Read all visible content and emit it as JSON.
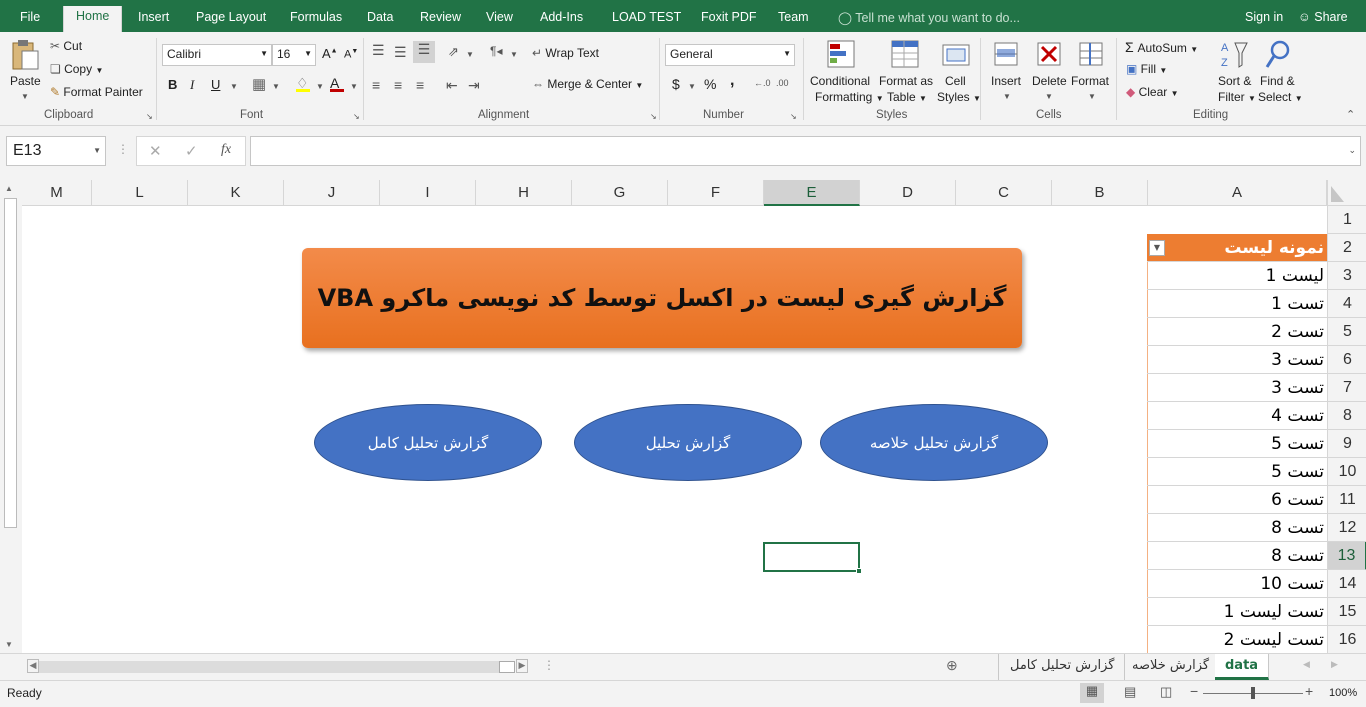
{
  "menu": {
    "tabs": [
      "File",
      "Home",
      "Insert",
      "Page Layout",
      "Formulas",
      "Data",
      "Review",
      "View",
      "Add-Ins",
      "LOAD TEST",
      "Foxit PDF",
      "Team"
    ],
    "active": "Home",
    "tell_me": "Tell me what you want to do...",
    "sign_in": "Sign in",
    "share": "Share"
  },
  "ribbon": {
    "clipboard": {
      "paste": "Paste",
      "cut": "Cut",
      "copy": "Copy",
      "format_painter": "Format Painter",
      "label": "Clipboard"
    },
    "font": {
      "name": "Calibri",
      "size": "16",
      "bold": "B",
      "italic": "I",
      "underline": "U",
      "label": "Font"
    },
    "alignment": {
      "wrap_text": "Wrap Text",
      "merge_center": "Merge & Center",
      "label": "Alignment"
    },
    "number": {
      "format": "General",
      "currency": "$",
      "percent": "%",
      "comma": ",",
      "label": "Number"
    },
    "styles": {
      "conditional": "Conditional",
      "conditional2": "Formatting",
      "format_as": "Format as",
      "format_as2": "Table",
      "cell": "Cell",
      "cell2": "Styles",
      "label": "Styles"
    },
    "cells": {
      "insert": "Insert",
      "delete": "Delete",
      "format": "Format",
      "label": "Cells"
    },
    "editing": {
      "autosum": "AutoSum",
      "fill": "Fill",
      "clear": "Clear",
      "sort": "Sort &",
      "sort2": "Filter",
      "find": "Find &",
      "find2": "Select",
      "label": "Editing"
    }
  },
  "formula_bar": {
    "name_box": "E13",
    "fx": "fx",
    "value": ""
  },
  "columns": [
    "M",
    "L",
    "K",
    "J",
    "I",
    "H",
    "G",
    "F",
    "E",
    "D",
    "C",
    "B",
    "A"
  ],
  "selected_column": "E",
  "rows": [
    "1",
    "2",
    "3",
    "4",
    "5",
    "6",
    "7",
    "8",
    "9",
    "10",
    "11",
    "12",
    "13",
    "14",
    "15",
    "16"
  ],
  "selected_row": "13",
  "table": {
    "header": "نمونه لیست",
    "values": [
      "لیست 1",
      "تست 1",
      "تست 2",
      "تست 3",
      "تست 3",
      "تست 4",
      "تست 5",
      "تست 5",
      "تست 6",
      "تست 8",
      "تست 8",
      "تست 10",
      "تست لیست 1",
      "تست لیست 2"
    ]
  },
  "banner": {
    "title": "گزارش گیری لیست در اکسل توسط کد نویسی ماکرو VBA"
  },
  "buttons": {
    "full": "گزارش تحلیل کامل",
    "report": "گزارش تحلیل",
    "summary": "گزارش تحلیل خلاصه"
  },
  "sheets": {
    "tabs": [
      "گزارش تحلیل کامل",
      "گزارش خلاصه",
      "data"
    ],
    "active": "data"
  },
  "status": {
    "ready": "Ready",
    "zoom": "100%"
  },
  "colors": {
    "excel_green": "#217346",
    "banner_orange": "#ed7d31",
    "button_blue": "#4472c4",
    "table_header": "#ed7d31"
  }
}
